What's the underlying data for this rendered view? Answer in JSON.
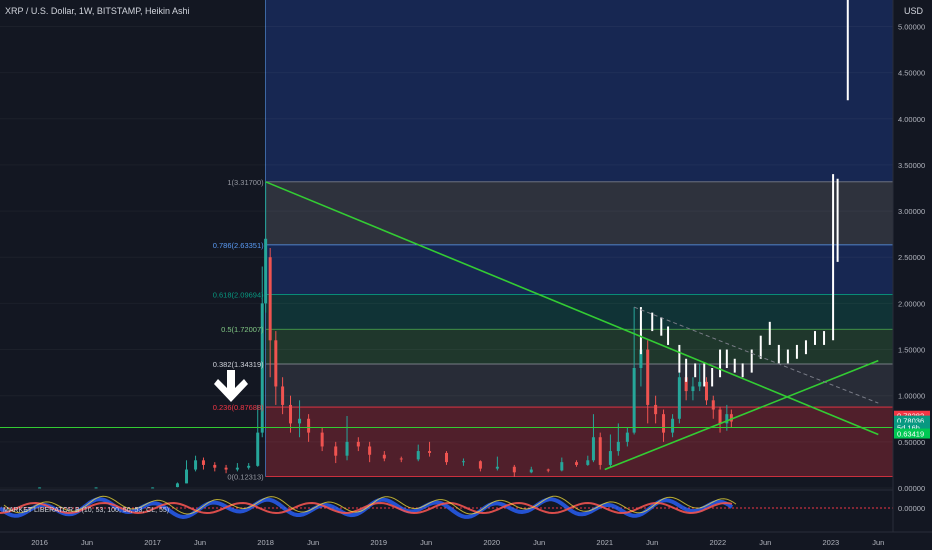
{
  "header": {
    "title": "XRP / U.S. Dollar, 1W, BITSTAMP, Heikin Ashi"
  },
  "colors": {
    "background": "#131722",
    "up_candle": "#26a69a",
    "down_candle": "#ef5350",
    "trendline": "#33cc33",
    "projection_candle": "#ffffff",
    "price_label_red": "#f23645",
    "price_label_teal": "#089981",
    "price_label_green": "#00c853"
  },
  "icons": {
    "annotation_arrow": "down-arrow-icon"
  },
  "chart_data": {
    "type": "candlestick",
    "price_unit": "USD",
    "ylim": [
      0,
      5.2
    ],
    "y_ticks": [
      "0.00000",
      "0.50000",
      "1.00000",
      "1.50000",
      "2.00000",
      "2.50000",
      "3.00000",
      "3.50000",
      "4.00000",
      "4.50000",
      "5.00000"
    ],
    "x_ticks": [
      {
        "label": "2016",
        "t": 2016.0
      },
      {
        "label": "Jun",
        "t": 2016.42
      },
      {
        "label": "2017",
        "t": 2017.0
      },
      {
        "label": "Jun",
        "t": 2017.42
      },
      {
        "label": "2018",
        "t": 2018.0
      },
      {
        "label": "Jun",
        "t": 2018.42
      },
      {
        "label": "2019",
        "t": 2019.0
      },
      {
        "label": "Jun",
        "t": 2019.42
      },
      {
        "label": "2020",
        "t": 2020.0
      },
      {
        "label": "Jun",
        "t": 2020.42
      },
      {
        "label": "2021",
        "t": 2021.0
      },
      {
        "label": "Jun",
        "t": 2021.42
      },
      {
        "label": "2022",
        "t": 2022.0
      },
      {
        "label": "Jun",
        "t": 2022.42
      },
      {
        "label": "2023",
        "t": 2023.0
      },
      {
        "label": "Jun",
        "t": 2023.42
      }
    ],
    "fib_levels": [
      {
        "label": "1(3.31700)",
        "value": 3.317,
        "fill": "rgba(120,123,134,0.28)",
        "line": "#787b86",
        "text": "#9598a1"
      },
      {
        "label": "0.786(2.63351)",
        "value": 2.63351,
        "fill": "rgba(41,98,255,0.22)",
        "line": "#5b9cf6",
        "text": "#5b9cf6"
      },
      {
        "label": "0.618(2.09694)",
        "value": 2.09694,
        "fill": "rgba(8,153,129,0.22)",
        "line": "#089981",
        "text": "#089981"
      },
      {
        "label": "0.5(1.72007)",
        "value": 1.72007,
        "fill": "rgba(76,175,80,0.22)",
        "line": "#4caf50",
        "text": "#81c784"
      },
      {
        "label": "0.382(1.34319)",
        "value": 1.34319,
        "fill": "rgba(120,123,134,0.22)",
        "line": "#9598a1",
        "text": "#d1d4dc"
      },
      {
        "label": "0.236(0.87688)",
        "value": 0.87688,
        "fill": "rgba(242,54,69,0.28)",
        "line": "#f23645",
        "text": "#f23645"
      },
      {
        "label": "0(0.12313)",
        "value": 0.12313,
        "fill": "",
        "line": "#f23645",
        "text": "#9598a1"
      }
    ],
    "price_labels": [
      {
        "text": "0.78282",
        "value": 0.78282,
        "color": "#f23645"
      },
      {
        "text": "0.78036",
        "value": 0.73,
        "color": "#089981"
      },
      {
        "text": "5d 16h",
        "value": 0.655,
        "color": "#089981"
      },
      {
        "text": "0.63419",
        "value": 0.59,
        "color": "#00c853"
      }
    ],
    "indicator": {
      "label": "MARKET LIBERATOR B (10, 53, 100, 50, 53, CL, 55)",
      "tick": "0.00000"
    },
    "candles": [
      {
        "t": 2016.0,
        "o": 0.006,
        "c": 0.006,
        "h": 0.007,
        "l": 0.005
      },
      {
        "t": 2016.5,
        "o": 0.006,
        "c": 0.006,
        "h": 0.007,
        "l": 0.005
      },
      {
        "t": 2017.0,
        "o": 0.006,
        "c": 0.006,
        "h": 0.007,
        "l": 0.005
      },
      {
        "t": 2017.22,
        "o": 0.01,
        "c": 0.05,
        "h": 0.06,
        "l": 0.008
      },
      {
        "t": 2017.3,
        "o": 0.05,
        "c": 0.2,
        "h": 0.3,
        "l": 0.05
      },
      {
        "t": 2017.38,
        "o": 0.2,
        "c": 0.3,
        "h": 0.35,
        "l": 0.18
      },
      {
        "t": 2017.45,
        "o": 0.3,
        "c": 0.25,
        "h": 0.33,
        "l": 0.2
      },
      {
        "t": 2017.55,
        "o": 0.25,
        "c": 0.22,
        "h": 0.28,
        "l": 0.18
      },
      {
        "t": 2017.65,
        "o": 0.22,
        "c": 0.2,
        "h": 0.25,
        "l": 0.16
      },
      {
        "t": 2017.75,
        "o": 0.2,
        "c": 0.22,
        "h": 0.27,
        "l": 0.18
      },
      {
        "t": 2017.85,
        "o": 0.22,
        "c": 0.24,
        "h": 0.27,
        "l": 0.2
      },
      {
        "t": 2017.93,
        "o": 0.24,
        "c": 0.6,
        "h": 0.9,
        "l": 0.23
      },
      {
        "t": 2017.97,
        "o": 0.6,
        "c": 2.0,
        "h": 2.4,
        "l": 0.55
      },
      {
        "t": 2018.0,
        "o": 2.0,
        "c": 2.7,
        "h": 3.317,
        "l": 1.9
      },
      {
        "t": 2018.04,
        "o": 2.5,
        "c": 1.6,
        "h": 2.6,
        "l": 1.2
      },
      {
        "t": 2018.09,
        "o": 1.6,
        "c": 1.1,
        "h": 1.7,
        "l": 0.9
      },
      {
        "t": 2018.15,
        "o": 1.1,
        "c": 0.9,
        "h": 1.2,
        "l": 0.8
      },
      {
        "t": 2018.22,
        "o": 0.9,
        "c": 0.7,
        "h": 1.0,
        "l": 0.6
      },
      {
        "t": 2018.3,
        "o": 0.7,
        "c": 0.75,
        "h": 0.95,
        "l": 0.55
      },
      {
        "t": 2018.38,
        "o": 0.75,
        "c": 0.6,
        "h": 0.8,
        "l": 0.5
      },
      {
        "t": 2018.5,
        "o": 0.6,
        "c": 0.45,
        "h": 0.65,
        "l": 0.4
      },
      {
        "t": 2018.62,
        "o": 0.45,
        "c": 0.35,
        "h": 0.5,
        "l": 0.27
      },
      {
        "t": 2018.72,
        "o": 0.35,
        "c": 0.5,
        "h": 0.78,
        "l": 0.3
      },
      {
        "t": 2018.82,
        "o": 0.5,
        "c": 0.45,
        "h": 0.55,
        "l": 0.4
      },
      {
        "t": 2018.92,
        "o": 0.45,
        "c": 0.36,
        "h": 0.5,
        "l": 0.28
      },
      {
        "t": 2019.05,
        "o": 0.36,
        "c": 0.32,
        "h": 0.4,
        "l": 0.29
      },
      {
        "t": 2019.2,
        "o": 0.32,
        "c": 0.31,
        "h": 0.34,
        "l": 0.28
      },
      {
        "t": 2019.35,
        "o": 0.31,
        "c": 0.4,
        "h": 0.47,
        "l": 0.29
      },
      {
        "t": 2019.45,
        "o": 0.4,
        "c": 0.38,
        "h": 0.5,
        "l": 0.34
      },
      {
        "t": 2019.6,
        "o": 0.38,
        "c": 0.28,
        "h": 0.4,
        "l": 0.25
      },
      {
        "t": 2019.75,
        "o": 0.28,
        "c": 0.29,
        "h": 0.32,
        "l": 0.24
      },
      {
        "t": 2019.9,
        "o": 0.29,
        "c": 0.21,
        "h": 0.3,
        "l": 0.18
      },
      {
        "t": 2020.05,
        "o": 0.21,
        "c": 0.23,
        "h": 0.34,
        "l": 0.19
      },
      {
        "t": 2020.2,
        "o": 0.23,
        "c": 0.17,
        "h": 0.25,
        "l": 0.12
      },
      {
        "t": 2020.35,
        "o": 0.17,
        "c": 0.2,
        "h": 0.23,
        "l": 0.16
      },
      {
        "t": 2020.5,
        "o": 0.2,
        "c": 0.19,
        "h": 0.21,
        "l": 0.17
      },
      {
        "t": 2020.62,
        "o": 0.19,
        "c": 0.28,
        "h": 0.33,
        "l": 0.18
      },
      {
        "t": 2020.75,
        "o": 0.28,
        "c": 0.25,
        "h": 0.3,
        "l": 0.23
      },
      {
        "t": 2020.85,
        "o": 0.25,
        "c": 0.3,
        "h": 0.35,
        "l": 0.24
      },
      {
        "t": 2020.9,
        "o": 0.3,
        "c": 0.55,
        "h": 0.8,
        "l": 0.28
      },
      {
        "t": 2020.96,
        "o": 0.55,
        "c": 0.25,
        "h": 0.6,
        "l": 0.2
      },
      {
        "t": 2021.05,
        "o": 0.25,
        "c": 0.4,
        "h": 0.58,
        "l": 0.22
      },
      {
        "t": 2021.12,
        "o": 0.4,
        "c": 0.5,
        "h": 0.7,
        "l": 0.35
      },
      {
        "t": 2021.2,
        "o": 0.5,
        "c": 0.6,
        "h": 0.65,
        "l": 0.45
      },
      {
        "t": 2021.26,
        "o": 0.6,
        "c": 1.3,
        "h": 1.96,
        "l": 0.58
      },
      {
        "t": 2021.32,
        "o": 1.3,
        "c": 1.5,
        "h": 1.7,
        "l": 1.1
      },
      {
        "t": 2021.38,
        "o": 1.5,
        "c": 0.9,
        "h": 1.6,
        "l": 0.7
      },
      {
        "t": 2021.45,
        "o": 0.9,
        "c": 0.8,
        "h": 1.0,
        "l": 0.7
      },
      {
        "t": 2021.52,
        "o": 0.8,
        "c": 0.6,
        "h": 0.85,
        "l": 0.5
      },
      {
        "t": 2021.6,
        "o": 0.6,
        "c": 0.75,
        "h": 0.8,
        "l": 0.55
      },
      {
        "t": 2021.66,
        "o": 0.75,
        "c": 1.2,
        "h": 1.3,
        "l": 0.7
      },
      {
        "t": 2021.72,
        "o": 1.2,
        "c": 1.05,
        "h": 1.25,
        "l": 0.95
      },
      {
        "t": 2021.78,
        "o": 1.05,
        "c": 1.1,
        "h": 1.2,
        "l": 0.95
      },
      {
        "t": 2021.84,
        "o": 1.1,
        "c": 1.15,
        "h": 1.35,
        "l": 1.05
      },
      {
        "t": 2021.9,
        "o": 1.15,
        "c": 0.95,
        "h": 1.2,
        "l": 0.9
      },
      {
        "t": 2021.96,
        "o": 0.95,
        "c": 0.85,
        "h": 1.0,
        "l": 0.75
      },
      {
        "t": 2022.02,
        "o": 0.85,
        "c": 0.7,
        "h": 0.88,
        "l": 0.6
      },
      {
        "t": 2022.08,
        "o": 0.7,
        "c": 0.8,
        "h": 0.9,
        "l": 0.62
      },
      {
        "t": 2022.12,
        "o": 0.8,
        "c": 0.72,
        "h": 0.85,
        "l": 0.65
      }
    ],
    "projection_candles": [
      {
        "t": 2021.32,
        "o": 1.5,
        "c": 1.9,
        "h": 1.96,
        "l": 1.45
      },
      {
        "t": 2021.42,
        "o": 1.75,
        "c": 1.85,
        "h": 1.9,
        "l": 1.7
      },
      {
        "t": 2021.5,
        "o": 1.7,
        "c": 1.8,
        "h": 1.85,
        "l": 1.65
      },
      {
        "t": 2021.56,
        "o": 1.7,
        "c": 1.6,
        "h": 1.75,
        "l": 1.55
      },
      {
        "t": 2021.66,
        "o": 1.5,
        "c": 1.3,
        "h": 1.55,
        "l": 1.25
      },
      {
        "t": 2021.72,
        "o": 1.35,
        "c": 1.2,
        "h": 1.4,
        "l": 1.15
      },
      {
        "t": 2021.8,
        "o": 1.25,
        "c": 1.3,
        "h": 1.35,
        "l": 1.2
      },
      {
        "t": 2021.88,
        "o": 1.3,
        "c": 1.15,
        "h": 1.35,
        "l": 1.1
      },
      {
        "t": 2021.95,
        "o": 1.15,
        "c": 1.25,
        "h": 1.3,
        "l": 1.1
      },
      {
        "t": 2022.02,
        "o": 1.25,
        "c": 1.45,
        "h": 1.5,
        "l": 1.2
      },
      {
        "t": 2022.08,
        "o": 1.45,
        "c": 1.35,
        "h": 1.5,
        "l": 1.3
      },
      {
        "t": 2022.15,
        "o": 1.35,
        "c": 1.3,
        "h": 1.4,
        "l": 1.25
      },
      {
        "t": 2022.22,
        "o": 1.3,
        "c": 1.25,
        "h": 1.35,
        "l": 1.2
      },
      {
        "t": 2022.3,
        "o": 1.3,
        "c": 1.45,
        "h": 1.5,
        "l": 1.25
      },
      {
        "t": 2022.38,
        "o": 1.45,
        "c": 1.6,
        "h": 1.65,
        "l": 1.4
      },
      {
        "t": 2022.46,
        "o": 1.6,
        "c": 1.75,
        "h": 1.8,
        "l": 1.55
      },
      {
        "t": 2022.54,
        "o": 1.5,
        "c": 1.4,
        "h": 1.55,
        "l": 1.35
      },
      {
        "t": 2022.62,
        "o": 1.45,
        "c": 1.4,
        "h": 1.5,
        "l": 1.35
      },
      {
        "t": 2022.7,
        "o": 1.5,
        "c": 1.45,
        "h": 1.55,
        "l": 1.4
      },
      {
        "t": 2022.78,
        "o": 1.55,
        "c": 1.5,
        "h": 1.6,
        "l": 1.45
      },
      {
        "t": 2022.86,
        "o": 1.6,
        "c": 1.65,
        "h": 1.7,
        "l": 1.55
      },
      {
        "t": 2022.94,
        "o": 1.65,
        "c": 1.6,
        "h": 1.7,
        "l": 1.55
      },
      {
        "t": 2023.02,
        "o": 1.65,
        "c": 3.4,
        "h": 3.4,
        "l": 1.6
      },
      {
        "t": 2023.06,
        "o": 3.3,
        "c": 2.5,
        "h": 3.35,
        "l": 2.45
      },
      {
        "t": 2023.15,
        "o": 4.2,
        "c": 5.3,
        "h": 5.3,
        "l": 4.2
      }
    ],
    "trendlines": [
      {
        "t1": 2018.0,
        "v1": 3.317,
        "t2": 2023.42,
        "v2": 0.58,
        "style": "solid"
      },
      {
        "t1": 2021.0,
        "v1": 0.2,
        "t2": 2023.42,
        "v2": 1.38,
        "style": "solid"
      },
      {
        "t1": 2021.26,
        "v1": 1.96,
        "t2": 2023.42,
        "v2": 0.92,
        "style": "dashed"
      }
    ],
    "horizontal_line": {
      "value": 0.655
    },
    "xlim": [
      2015.65,
      2023.55
    ]
  }
}
